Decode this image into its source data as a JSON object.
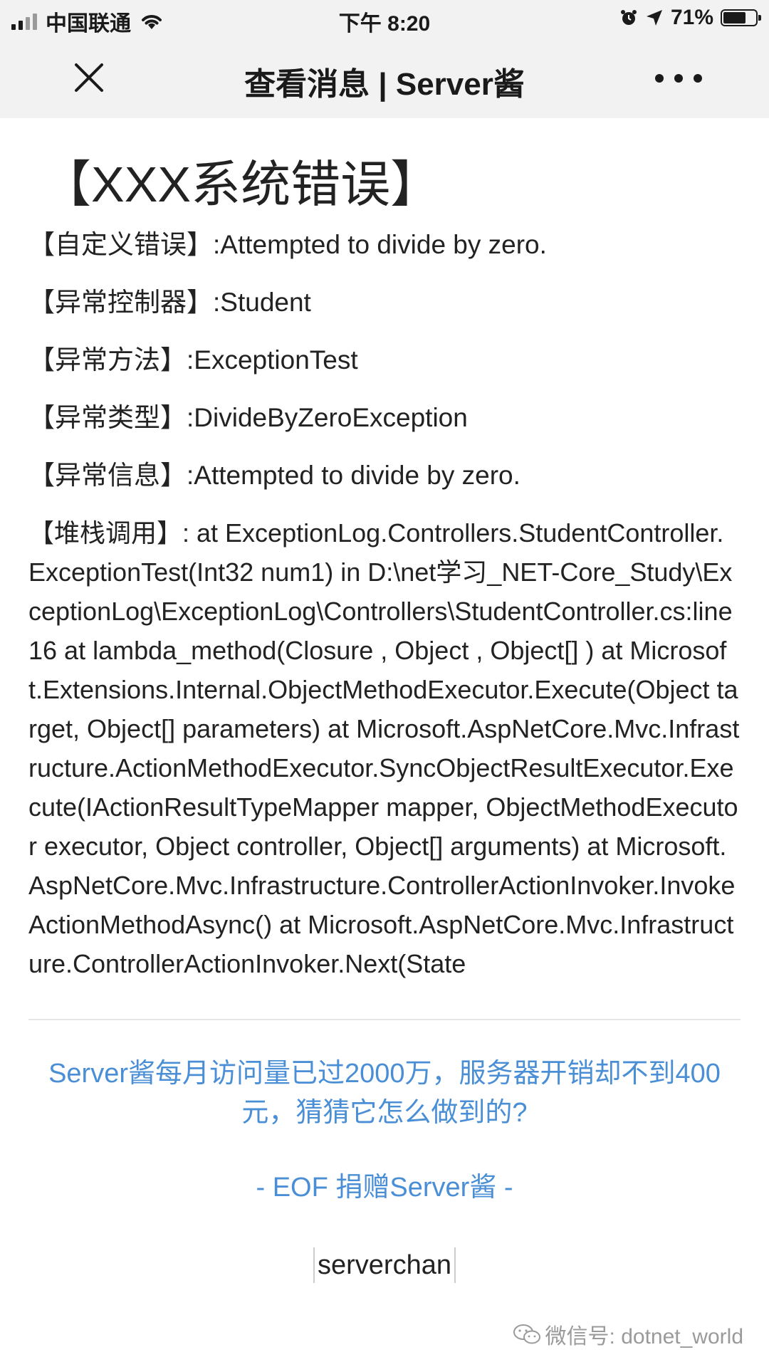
{
  "status_bar": {
    "carrier": "中国联通",
    "time": "下午 8:20",
    "battery_percent": "71%",
    "battery_level": 0.71
  },
  "nav": {
    "title": "查看消息 | Server酱",
    "close_icon": "close-icon",
    "more_icon": "more-icon"
  },
  "message": {
    "title": "【XXX系统错误】",
    "fields": [
      "【自定义错误】:Attempted to divide by zero.",
      "【异常控制器】:Student",
      "【异常方法】:ExceptionTest",
      "【异常类型】:DivideByZeroException",
      "【异常信息】:Attempted to divide by zero."
    ],
    "stack": "【堆栈调用】: at ExceptionLog.Controllers.StudentController.ExceptionTest(Int32 num1) in D:\\net学习_NET-Core_Study\\ExceptionLog\\ExceptionLog\\Controllers\\StudentController.cs:line 16 at lambda_method(Closure , Object , Object[] ) at Microsoft.Extensions.Internal.ObjectMethodExecutor.Execute(Object target, Object[] parameters) at Microsoft.AspNetCore.Mvc.Infrastructure.ActionMethodExecutor.SyncObjectResultExecutor.Execute(IActionResultTypeMapper mapper, ObjectMethodExecutor executor, Object controller, Object[] arguments) at Microsoft.AspNetCore.Mvc.Infrastructure.ControllerActionInvoker.InvokeActionMethodAsync() at Microsoft.AspNetCore.Mvc.Infrastructure.ControllerActionInvoker.Next(State"
  },
  "footer": {
    "promo": "Server酱每月访问量已过2000万，服务器开销却不到400元，猜猜它怎么做到的?",
    "eof": "- EOF 捐赠Server酱 -",
    "tag": "serverchan",
    "watermark": "微信号: dotnet_world"
  },
  "colors": {
    "link": "#4a8fd6",
    "bar_bg": "#f2f2f2"
  }
}
